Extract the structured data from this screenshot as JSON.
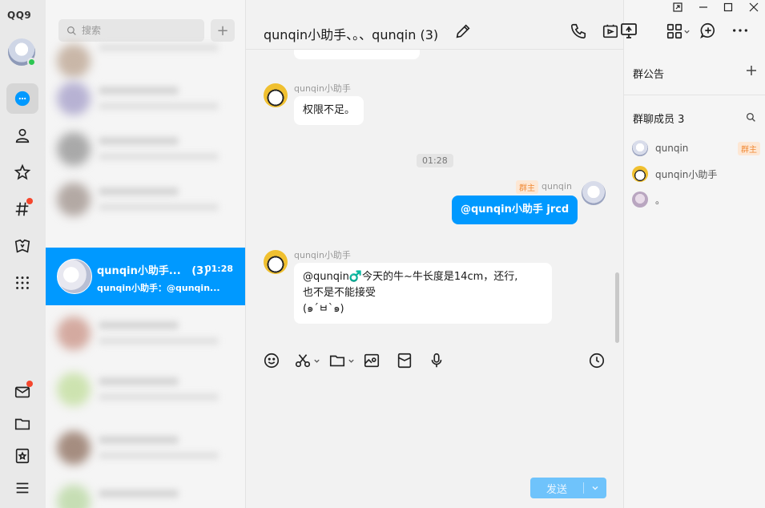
{
  "app": {
    "logo_text": "QQ9"
  },
  "search": {
    "placeholder": "搜索"
  },
  "list": {
    "active_conversation": {
      "name": "qunqin小助手...",
      "count": "(3)",
      "time": "01:28",
      "last_message": "qunqin小助手：@qunqin..."
    }
  },
  "chat": {
    "title": "qunqin小助手、。、qunqin (3)",
    "time_divider": "01:28",
    "messages": [
      {
        "sender": "qunqin小助手",
        "text": "权限不足。"
      },
      {
        "sender": "qunqin",
        "owner_tag": "群主",
        "text": "@qunqin小助手 jrcd"
      },
      {
        "sender": "qunqin小助手",
        "line1": "@qunqin♂️今天的牛~牛长度是14cm，还行,",
        "line2": "也不是不能接受",
        "line3": "(๑´ㅂ`๑)"
      }
    ],
    "send_label": "发送"
  },
  "panel": {
    "announcement_title": "群公告",
    "members_title": "群聊成员 3",
    "members": [
      {
        "name": "qunqin",
        "tag": "群主"
      },
      {
        "name": "qunqin小助手",
        "tag": ""
      },
      {
        "name": "。",
        "tag": ""
      }
    ]
  },
  "colors": {
    "accent": "#0099ff",
    "badge": "#f5462d",
    "online": "#2dc652",
    "owner_tag": "#f08a36"
  }
}
